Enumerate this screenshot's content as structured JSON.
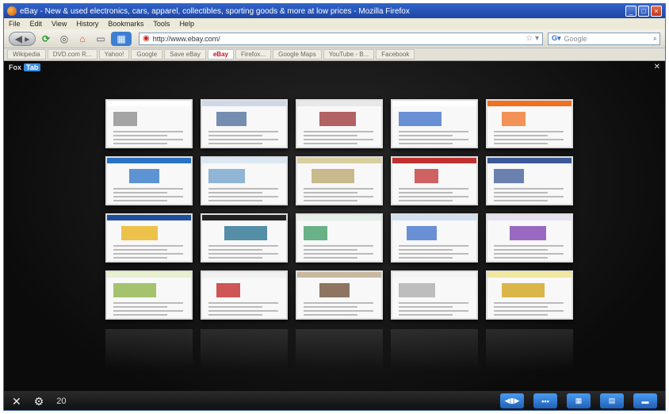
{
  "window": {
    "title": "eBay - New & used electronics, cars, apparel, collectibles, sporting goods & more at low prices - Mozilla Firefox"
  },
  "menu": [
    "File",
    "Edit",
    "View",
    "History",
    "Bookmarks",
    "Tools",
    "Help"
  ],
  "toolbar": {
    "url": "http://www.ebay.com/",
    "search_placeholder": "Google"
  },
  "tabs": [
    {
      "label": "Wikipedia",
      "active": false
    },
    {
      "label": "DVD.com R...",
      "active": false
    },
    {
      "label": "Yahoo!",
      "active": false
    },
    {
      "label": "Google",
      "active": false
    },
    {
      "label": "Save eBay",
      "active": false
    },
    {
      "label": "eBay",
      "active": true
    },
    {
      "label": "Firefox...",
      "active": false
    },
    {
      "label": "Google Maps",
      "active": false
    },
    {
      "label": "YouTube - B...",
      "active": false
    },
    {
      "label": "Facebook",
      "active": false
    }
  ],
  "foxtab": {
    "label": "Fox",
    "badge": "Tab",
    "tab_count": "20",
    "thumbnails": [
      {
        "name": "wikipedia",
        "bar": "#ffffff",
        "accent": "#888888"
      },
      {
        "name": "news",
        "bar": "#cfd8e8",
        "accent": "#4a6a9a"
      },
      {
        "name": "blog",
        "bar": "#e8e8e8",
        "accent": "#9a3030"
      },
      {
        "name": "google",
        "bar": "#ffffff",
        "accent": "#3a6ec9"
      },
      {
        "name": "firefox",
        "bar": "#f07020",
        "accent": "#f07020"
      },
      {
        "name": "windows",
        "bar": "#2a72c6",
        "accent": "#2a72c6"
      },
      {
        "name": "map-site",
        "bar": "#dbe8f2",
        "accent": "#6f9fc8"
      },
      {
        "name": "maps",
        "bar": "#d8cfa0",
        "accent": "#b9a66a"
      },
      {
        "name": "shop",
        "bar": "#c03030",
        "accent": "#c03030"
      },
      {
        "name": "facebook",
        "bar": "#3b5998",
        "accent": "#3b5998"
      },
      {
        "name": "ebay",
        "bar": "#1f4e9c",
        "accent": "#e8b010"
      },
      {
        "name": "media",
        "bar": "#222222",
        "accent": "#1e6b8c"
      },
      {
        "name": "forum",
        "bar": "#e6f0e6",
        "accent": "#3a9a60"
      },
      {
        "name": "portal",
        "bar": "#d0e0f0",
        "accent": "#3a6ec9"
      },
      {
        "name": "yahoo",
        "bar": "#e8e0f0",
        "accent": "#7a3ab0"
      },
      {
        "name": "store",
        "bar": "#e8f0d0",
        "accent": "#8ab040"
      },
      {
        "name": "youtube",
        "bar": "#f0f0f0",
        "accent": "#c02020"
      },
      {
        "name": "photo",
        "bar": "#c8b8a0",
        "accent": "#6a4a30"
      },
      {
        "name": "login",
        "bar": "#f4f4f4",
        "accent": "#aaaaaa"
      },
      {
        "name": "dvd",
        "bar": "#f0e8a0",
        "accent": "#d0a010"
      }
    ]
  },
  "icons": {
    "fullscreen": "fullscreen-icon",
    "settings": "gear-icon"
  }
}
